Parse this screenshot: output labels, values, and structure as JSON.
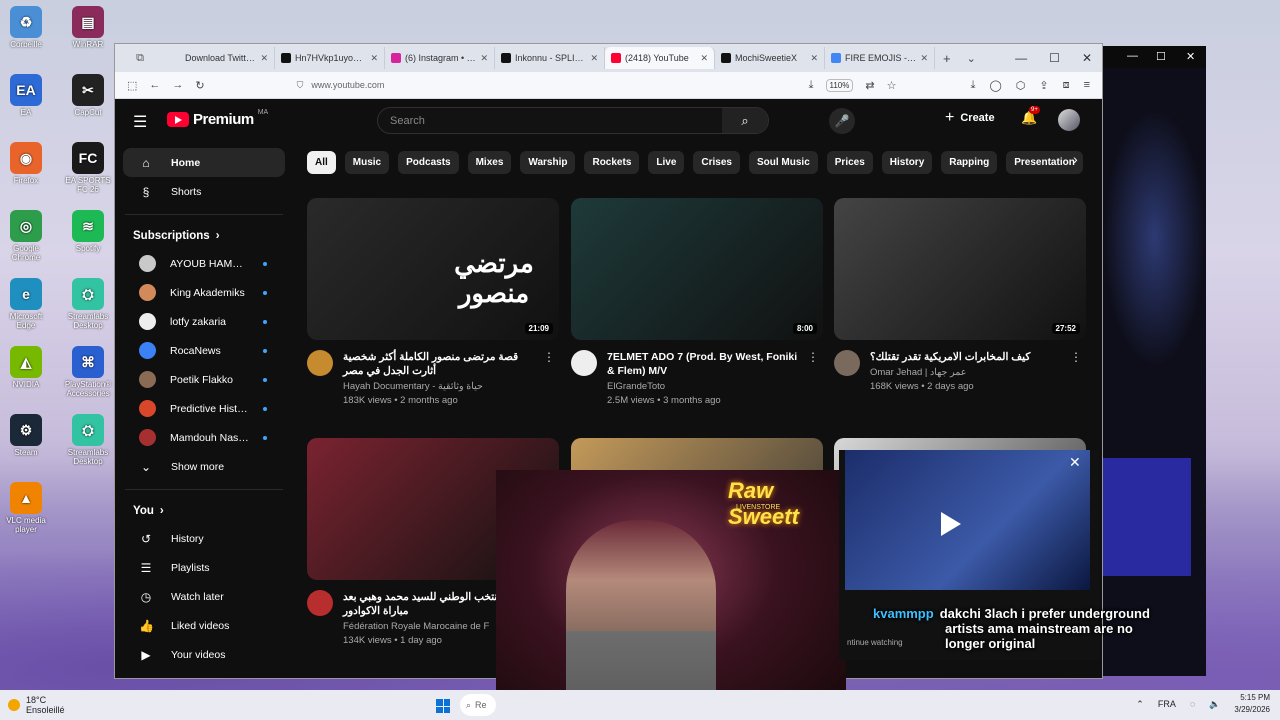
{
  "desktop": {
    "icons": [
      {
        "label": "Corbeille",
        "color": "#4a8fd6",
        "glyph": "♻"
      },
      {
        "label": "WinRAR",
        "color": "#8b2b5c",
        "glyph": "▤"
      },
      {
        "label": "EA",
        "color": "#2d6ad6",
        "glyph": "EA"
      },
      {
        "label": "CapCut",
        "color": "#222222",
        "glyph": "✂"
      },
      {
        "label": "Firefox",
        "color": "#e8642b",
        "glyph": "◉"
      },
      {
        "label": "EA SPORTS FC 26",
        "color": "#1a1a1a",
        "glyph": "FC"
      },
      {
        "label": "Google Chrome",
        "color": "#2d9d4c",
        "glyph": "◎"
      },
      {
        "label": "Spotify",
        "color": "#1db954",
        "glyph": "≋"
      },
      {
        "label": "Microsoft Edge",
        "color": "#1e8fbf",
        "glyph": "e"
      },
      {
        "label": "Streamlabs Desktop",
        "color": "#31c3a2",
        "glyph": "⛭"
      },
      {
        "label": "NVIDIA",
        "color": "#76b900",
        "glyph": "◭"
      },
      {
        "label": "PlayStation® Accessories",
        "color": "#2a5fd0",
        "glyph": "⌘"
      },
      {
        "label": "Steam",
        "color": "#1b2838",
        "glyph": "⚙"
      },
      {
        "label": "Streamlabs Desktop",
        "color": "#31c3a2",
        "glyph": "⛭"
      },
      {
        "label": "VLC media player",
        "color": "#f08400",
        "glyph": "▲"
      }
    ]
  },
  "browser": {
    "tabs": [
      {
        "label": "Download Twitter Video",
        "color": "#dfe3ec"
      },
      {
        "label": "Hn7HVkp1uyoU3d",
        "color": "#111111"
      },
      {
        "label": "(6) Instagram • Mes",
        "color": "#d6249f"
      },
      {
        "label": "Inkonnu - SPLIT | Ti",
        "color": "#111111"
      },
      {
        "label": "(2418) YouTube",
        "color": "#ff0033"
      },
      {
        "label": "MochiSweetieX",
        "color": "#111111"
      },
      {
        "label": "FIRE EMOJIS - بحث",
        "color": "#4285f4"
      }
    ],
    "url": "www.youtube.com",
    "zoom": "110%"
  },
  "youtube": {
    "logo_text": "Premium",
    "country_code": "MA",
    "search_placeholder": "Search",
    "create_label": "Create",
    "notif_badge": "9+",
    "nav": [
      {
        "label": "Home",
        "icon": "home-icon",
        "glyph": "⌂"
      },
      {
        "label": "Shorts",
        "icon": "shorts-icon",
        "glyph": "§"
      }
    ],
    "subscriptions_heading": "Subscriptions",
    "subscriptions": [
      {
        "name": "AYOUB HAMDA...",
        "color": "#c9c9c9"
      },
      {
        "name": "King Akademiks",
        "color": "#d28a5a"
      },
      {
        "name": "lotfy zakaria",
        "color": "#eeeeee"
      },
      {
        "name": "RocaNews",
        "color": "#3b82f6"
      },
      {
        "name": "Poetik Flakko",
        "color": "#8a6b55"
      },
      {
        "name": "Predictive History",
        "color": "#d9472b"
      },
      {
        "name": "Mamdouh NasrA...",
        "color": "#a63030"
      }
    ],
    "show_more": "Show more",
    "you_heading": "You",
    "you_items": [
      {
        "label": "History",
        "icon": "history-icon",
        "glyph": "↺"
      },
      {
        "label": "Playlists",
        "icon": "playlists-icon",
        "glyph": "☰"
      },
      {
        "label": "Watch later",
        "icon": "watch-later-icon",
        "glyph": "◷"
      },
      {
        "label": "Liked videos",
        "icon": "like-icon",
        "glyph": "👍"
      },
      {
        "label": "Your videos",
        "icon": "your-videos-icon",
        "glyph": "▶"
      }
    ],
    "chips": [
      "All",
      "Music",
      "Podcasts",
      "Mixes",
      "Warship",
      "Rockets",
      "Live",
      "Crises",
      "Soul Music",
      "Prices",
      "History",
      "Rapping",
      "Presentation"
    ],
    "videos": [
      {
        "title": "قصة مرتضى منصور الكاملة أكثر شخصية أثارت الجدل في مصر",
        "channel": "Hayah Documentary - حياة وثائقية",
        "stats": "183K views • 2 months ago",
        "duration": "21:09",
        "overlay_text": "مرتضي منصور",
        "thumb_color": "#2a2a2a",
        "avatar_color": "#c58b2e"
      },
      {
        "title": "7ELMET ADO 7 (Prod. By West, Foniki & Flem) M/V",
        "channel": "ElGrandeToto",
        "stats": "2.5M views • 3 months ago",
        "duration": "8:00",
        "overlay_text": "",
        "thumb_color": "#1e3a3a",
        "avatar_color": "#eeeeee"
      },
      {
        "title": "كيف المخابرات الامريكية تقدر تقتلك؟",
        "channel": "Omar Jehad | عمر جهاد",
        "stats": "168K views • 2 days ago",
        "duration": "27:52",
        "overlay_text": "",
        "thumb_color": "#444444",
        "avatar_color": "#7a6a5e"
      },
      {
        "title": "مافية للمنتخب الوطني للسيد محمد وهبي بعد مباراة الاكوادور",
        "channel": "Fédération Royale Marocaine de F",
        "stats": "134K views • 1 day ago",
        "duration": "",
        "overlay_text": "",
        "thumb_color": "#7a2330",
        "avatar_color": "#b82d2d"
      }
    ]
  },
  "overlay": {
    "stream_logo": "Raw Sweett",
    "stream_logo_sub": "LIVENSTORE",
    "chat_user": "kvammpp",
    "chat_lines": [
      "dakchi 3lach i prefer underground",
      "artists ama mainstream are no",
      "longer original"
    ],
    "pip_caption": "ntinue watching"
  },
  "taskbar": {
    "temp": "18°C",
    "weather": "Ensoleillé",
    "search": "Re",
    "lang": "FRA",
    "time": "5:15 PM",
    "date": "3/29/2026"
  }
}
